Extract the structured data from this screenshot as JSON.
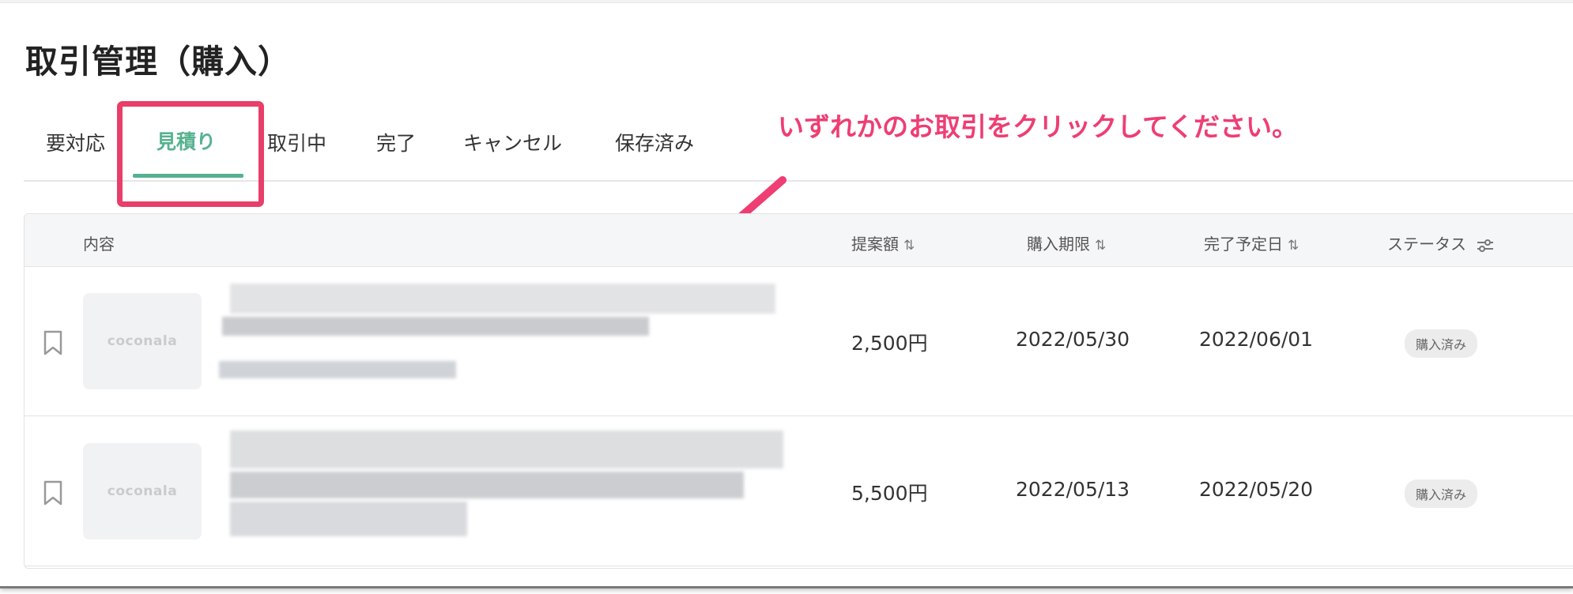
{
  "page": {
    "title": "取引管理（購入）"
  },
  "tabs": [
    {
      "label": "要対応"
    },
    {
      "label": "見積り",
      "active": true
    },
    {
      "label": "取引中"
    },
    {
      "label": "完了"
    },
    {
      "label": "キャンセル"
    },
    {
      "label": "保存済み"
    }
  ],
  "annotation": {
    "text": "いずれかのお取引をクリックしてください。",
    "color": "#ee3e73",
    "highlight_color": "#e83e6a"
  },
  "table": {
    "headers": {
      "content": "内容",
      "amount": "提案額",
      "purchase_deadline": "購入期限",
      "completion_date": "完了予定日",
      "status": "ステータス"
    },
    "sort_icon": "⇅",
    "filter_icon": "filter-icon",
    "rows": [
      {
        "thumb": "coconala",
        "amount": "2,500円",
        "purchase_deadline": "2022/05/30",
        "completion_date": "2022/06/01",
        "status": "購入済み"
      },
      {
        "thumb": "coconala",
        "amount": "5,500円",
        "purchase_deadline": "2022/05/13",
        "completion_date": "2022/05/20",
        "status": "購入済み"
      }
    ]
  },
  "colors": {
    "accent": "#56b28e"
  }
}
